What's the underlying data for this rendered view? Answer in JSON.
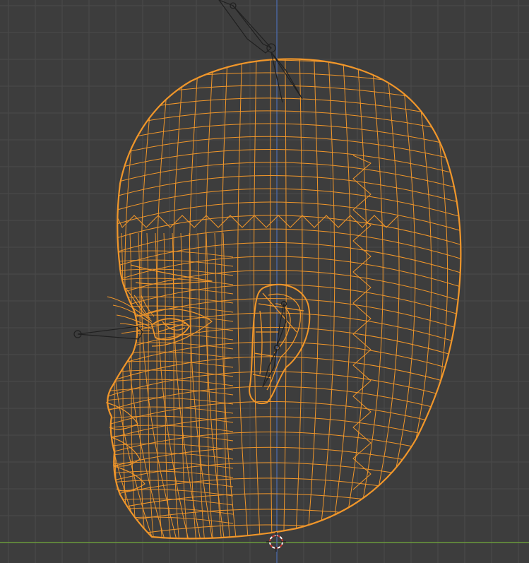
{
  "viewport": {
    "view": "side-orthographic",
    "background_color": "#3d3d3d",
    "grid_color": "#4a4a4a",
    "grid_major_color": "#555555",
    "x_axis_color": "#6b9a3d",
    "z_axis_color": "#4c6fb3"
  },
  "object": {
    "type": "head-mesh",
    "display": "wireframe",
    "selected": true,
    "wire_color": "#f0962a"
  },
  "armature": {
    "color": "#202020"
  },
  "cursor": {
    "icon": "3d-cursor-icon",
    "ring_color": "#c8362f",
    "ring_alt_color": "#ffffff"
  }
}
